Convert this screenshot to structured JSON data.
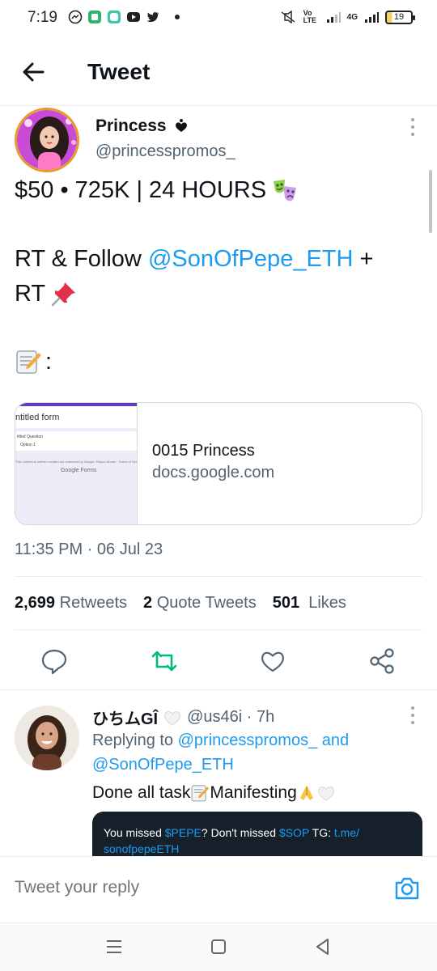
{
  "status_bar": {
    "time": "7:19",
    "network_label": "Vo LTE",
    "signal_label": "4G",
    "battery": "19"
  },
  "header": {
    "title": "Tweet",
    "back_icon": "arrow-left-icon"
  },
  "tweet": {
    "author_name": "Princess",
    "author_handle": "@princesspromos_",
    "line1": "$50 • 725K | 24 HOURS",
    "line2_prefix": "RT & Follow ",
    "line2_mention": "@SonOfPepe_ETH",
    "line2_suffix": " +",
    "line3": "RT",
    "line4": ":",
    "card": {
      "thumb_title": "ntitled form",
      "thumb_question": "titled Question",
      "thumb_option": "Option 1",
      "thumb_footer": "This content is neither created nor endorsed by Google. Report Abuse · Terms of Service · Privacy Policy",
      "thumb_brand": "Google Forms",
      "title": "0015 Princess",
      "domain": "docs.google.com"
    },
    "timestamp": "11:35 PM · 06 Jul 23",
    "stats": {
      "retweets_count": "2,699",
      "retweets_label": "Retweets",
      "quotes_count": "2",
      "quotes_label": "Quote Tweets",
      "likes_count": "501",
      "likes_label": "Likes"
    }
  },
  "reply": {
    "name": "ひちムGÎ",
    "handle_time": "@us46i · 7h",
    "replying_prefix": "Replying to ",
    "replying_to_1": "@princesspromos_",
    "replying_and": " and",
    "replying_to_2": "@SonOfPepe_ETH",
    "text_1": "Done all task",
    "text_2": "Manifesting"
  },
  "ad": {
    "text_1": "You missed ",
    "token_1": "$PEPE",
    "text_2": "? Don't missed ",
    "token_2": "$SOP",
    "text_3": " TG: ",
    "link": "t.me/",
    "link_2": "sonofpepeETH"
  },
  "composer": {
    "placeholder": "Tweet your reply"
  },
  "colors": {
    "link": "#1d9bf0",
    "retweet_active": "#00ba7c",
    "secondary_text": "#536471"
  }
}
